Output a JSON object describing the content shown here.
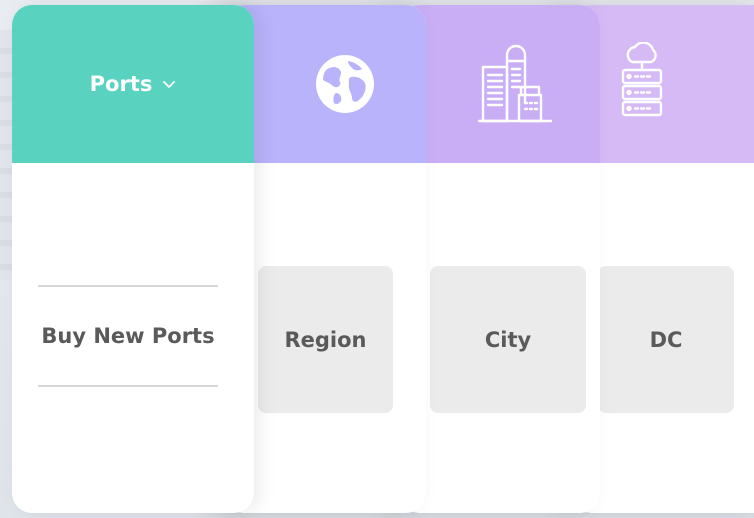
{
  "ports_menu": {
    "label": "Ports",
    "action_label": "Buy New Ports"
  },
  "columns": [
    {
      "id": "region",
      "label": "Region",
      "icon": "globe-icon"
    },
    {
      "id": "city",
      "label": "City",
      "icon": "buildings-icon"
    },
    {
      "id": "dc",
      "label": "DC",
      "icon": "server-rack-icon"
    }
  ],
  "colors": {
    "ports_header": "#59d2bf",
    "region_header": "#b8b3fb",
    "city_header": "#c9aef5",
    "dc_header": "#d6baf6",
    "panel": "#ebebeb",
    "text": "#5a5a5a"
  }
}
